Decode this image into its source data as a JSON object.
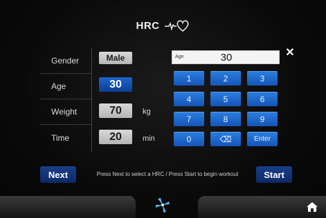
{
  "header": {
    "title": "HRC",
    "icon": "heartbeat-heart-icon"
  },
  "form": {
    "rows": [
      {
        "label": "Gender",
        "value": "Male",
        "unit": ""
      },
      {
        "label": "Age",
        "value": "30",
        "unit": ""
      },
      {
        "label": "Weight",
        "value": "70",
        "unit": "kg"
      },
      {
        "label": "Time",
        "value": "20",
        "unit": "min"
      }
    ]
  },
  "keypad": {
    "display_label": "Age",
    "display_value": "30",
    "keys": [
      "1",
      "2",
      "3",
      "4",
      "5",
      "6",
      "7",
      "8",
      "9",
      "0",
      "⌫",
      "Enter"
    ]
  },
  "actions": {
    "next_label": "Next",
    "start_label": "Start",
    "hint": "Press Next to select a HRC  /  Press Start to begin workout"
  },
  "colors": {
    "key_blue": "#2b7fe0",
    "selected_blue": "#1654b8",
    "button_navy": "#1a3e8a",
    "background": "#060606"
  },
  "bottom_bar": {
    "center_icon": "fan-icon",
    "right_icon": "home-icon"
  }
}
